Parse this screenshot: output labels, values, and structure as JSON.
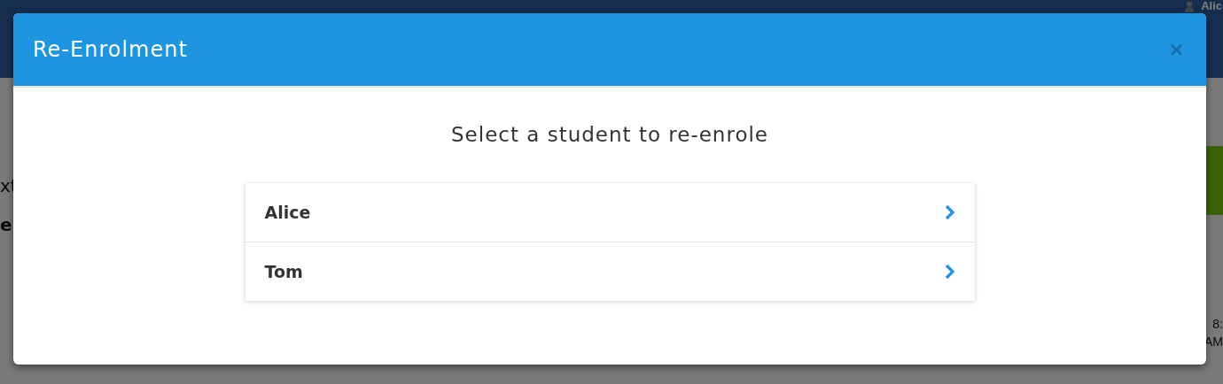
{
  "background": {
    "user": "Alic",
    "left_texts": [
      "xt",
      "e"
    ],
    "right_texts": [
      "8:",
      "AM"
    ]
  },
  "modal": {
    "title": "Re-Enrolment",
    "close": "×",
    "heading": "Select a student to re-enrole",
    "students": [
      {
        "name": "Alice"
      },
      {
        "name": "Tom"
      }
    ]
  }
}
